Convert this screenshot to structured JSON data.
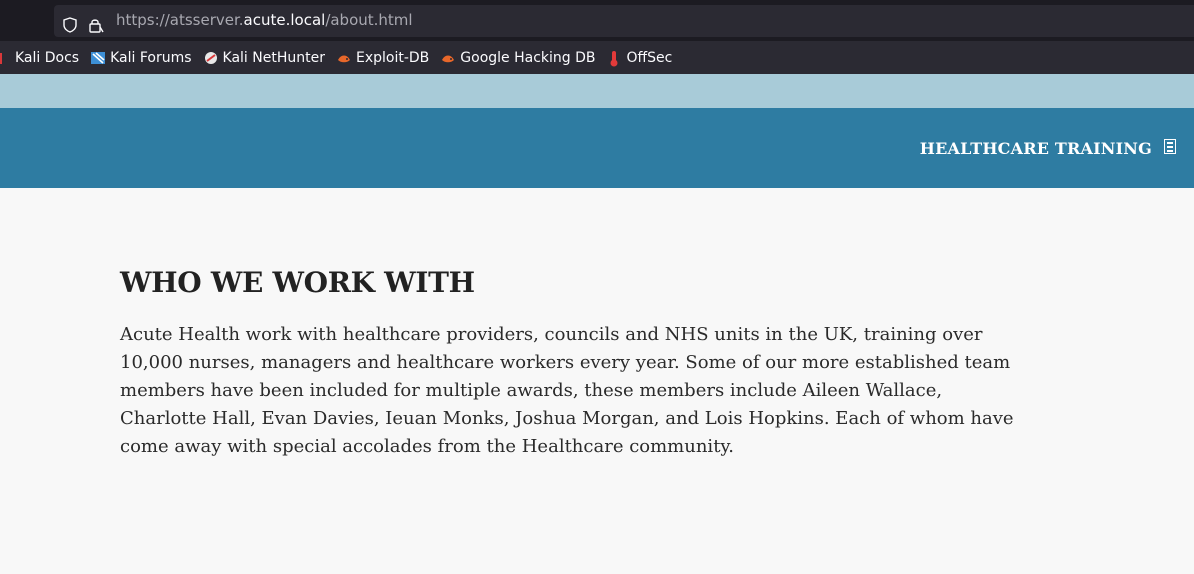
{
  "browser": {
    "url_prefix": "https://atsserver.",
    "url_host": "acute.local",
    "url_suffix": "/about.html",
    "bookmarks": [
      {
        "label": "Kali Docs",
        "icon": "kali-docs-icon"
      },
      {
        "label": "Kali Forums",
        "icon": "kali-forums-icon"
      },
      {
        "label": "Kali NetHunter",
        "icon": "kali-nethunter-icon"
      },
      {
        "label": "Exploit-DB",
        "icon": "exploit-db-icon"
      },
      {
        "label": "Google Hacking DB",
        "icon": "google-hacking-db-icon"
      },
      {
        "label": "OffSec",
        "icon": "offsec-icon"
      }
    ]
  },
  "header": {
    "nav_title": "HEALTHCARE TRAINING",
    "menu_icon": "menu-toggle-icon",
    "color": "#2e7ca2"
  },
  "main": {
    "heading": "WHO WE WORK WITH",
    "body": "Acute Health work with healthcare providers, councils and NHS units in the UK, training over 10,000 nurses, managers and healthcare workers every year. Some of our more established team members have been included for multiple awards, these members include Aileen Wallace, Charlotte Hall, Evan Davies, Ieuan Monks, Joshua Morgan, and Lois Hopkins. Each of whom have come away with special accolades from the Healthcare community."
  }
}
